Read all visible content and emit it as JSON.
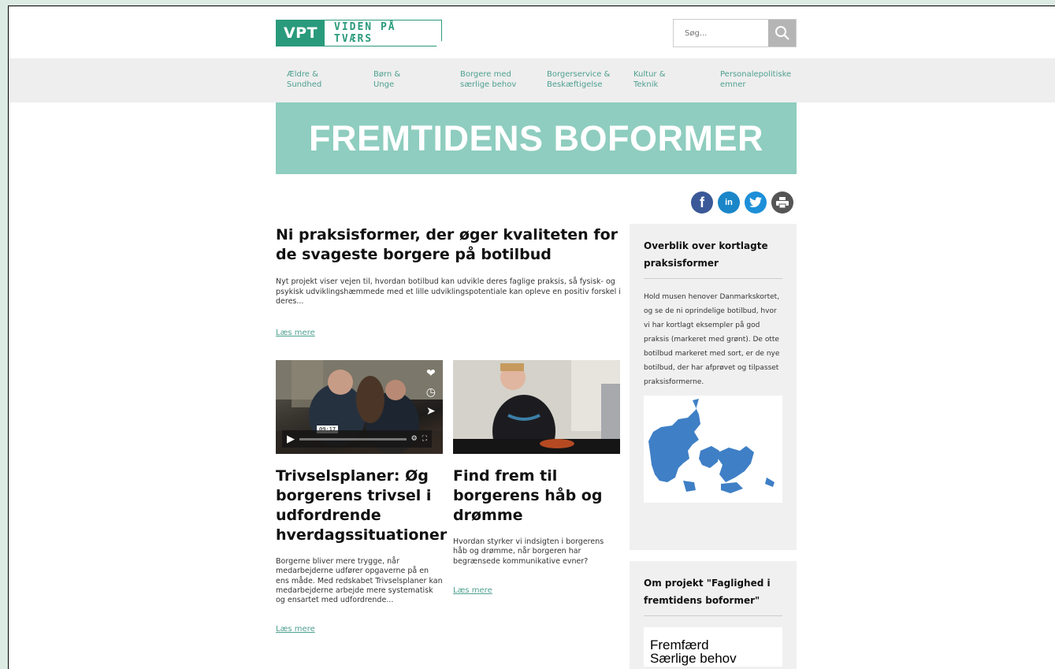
{
  "header": {
    "logo_short": "VPT",
    "logo_long": "VIDEN PÅ TVÆRS",
    "search_placeholder": "Søg..."
  },
  "nav": [
    {
      "line1": "Ældre &",
      "line2": "Sundhed"
    },
    {
      "line1": "Børn &",
      "line2": "Unge"
    },
    {
      "line1": "Borgere med",
      "line2": "særlige behov"
    },
    {
      "line1": "Borgerservice &",
      "line2": "Beskæftigelse"
    },
    {
      "line1": "Kultur &",
      "line2": "Teknik"
    },
    {
      "line1": "Personalepolitiske",
      "line2": "emner"
    }
  ],
  "banner": {
    "title": "FREMTIDENS BOFORMER"
  },
  "main_article": {
    "title": "Ni praksisformer, der øger kvaliteten for de svageste borgere på botilbud",
    "summary": "Nyt projekt viser vejen til, hvordan botilbud kan udvikle deres faglige praksis, så fysisk- og psykisk udviklingshæmmede med et lille udviklingspotentiale kan opleve en positiv forskel i deres...",
    "read_more": "Læs mere"
  },
  "cards": [
    {
      "video_time": "09:17",
      "title": "Trivselsplaner: Øg borgerens trivsel i udfordrende hverdagssituationer",
      "summary": "Borgerne bliver mere trygge, når medarbejderne udfører opgaverne på en ens måde. Med redskabet Trivselsplaner kan medarbejderne arbejde mere systematisk og ensartet med udfordrende...",
      "read_more": "Læs mere"
    },
    {
      "title": "Find frem til borgerens håb og drømme",
      "summary": "Hvordan styrker vi indsigten i borgerens håb og drømme, når borgeren har begrænsede kommunikative evner?",
      "read_more": "Læs mere"
    }
  ],
  "sidebar": {
    "box1_title": "Overblik over kortlagte praksisformer",
    "box1_text": "Hold musen henover Danmarkskortet, og se de ni oprindelige botilbud, hvor vi har kortlagt eksempler på god praksis (markeret med grønt). De otte botilbud markeret med sort, er de nye botilbud, der har afprøvet og tilpasset praksisformerne.",
    "box2_title": "Om projekt \"Faglighed i fremtidens boformer\"",
    "box2_logo_line1": "Fremfærd",
    "box2_logo_line2": "Særlige behov"
  },
  "colors": {
    "brand": "#2a9a7c",
    "banner": "#8ecdbf",
    "link": "#4ea090",
    "map": "#3f7fc6"
  }
}
